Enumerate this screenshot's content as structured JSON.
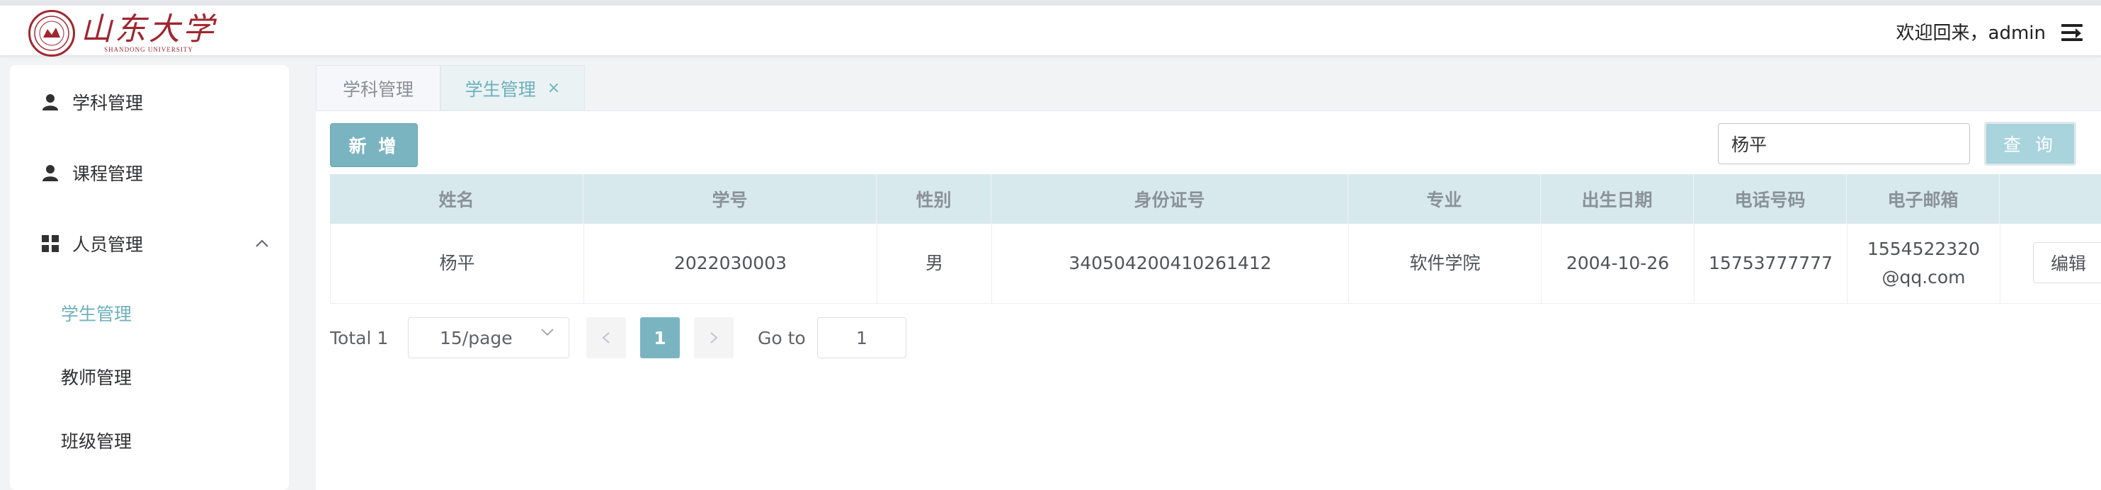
{
  "header": {
    "logo_cn": "山东大学",
    "logo_en": "SHANDONG UNIVERSITY",
    "welcome": "欢迎回来，admin",
    "menu_icon": "menu-fold-icon"
  },
  "sidebar": {
    "items": [
      {
        "label": "学科管理",
        "icon": "user-icon"
      },
      {
        "label": "课程管理",
        "icon": "user-icon"
      },
      {
        "label": "人员管理",
        "icon": "grid-icon",
        "expanded": true
      }
    ],
    "subitems": [
      {
        "label": "学生管理",
        "active": true
      },
      {
        "label": "教师管理",
        "active": false
      },
      {
        "label": "班级管理",
        "active": false
      }
    ]
  },
  "tabs": [
    {
      "label": "学科管理",
      "active": false
    },
    {
      "label": "学生管理",
      "active": true,
      "closable": true
    }
  ],
  "toolbar": {
    "add_label": "新 增",
    "search_value": "杨平",
    "query_label": "查 询"
  },
  "table": {
    "columns": [
      "姓名",
      "学号",
      "性别",
      "身份证号",
      "专业",
      "出生日期",
      "电话号码",
      "电子邮箱"
    ],
    "rows": [
      {
        "name": "杨平",
        "student_id": "2022030003",
        "gender": "男",
        "id_card": "340504200410261412",
        "major": "软件学院",
        "birth": "2004-10-26",
        "phone": "15753777777",
        "email_line1": "1554522320",
        "email_line2": "@qq.com",
        "edit_label": "编辑"
      }
    ]
  },
  "pagination": {
    "total": "Total 1",
    "page_size": "15/page",
    "current": "1",
    "goto_label": "Go to",
    "goto_value": "1"
  },
  "colors": {
    "accent": "#7ab4c1",
    "active_text": "#6fb0bd",
    "header_row": "#d8e9ed",
    "brand_red": "#a0262e"
  }
}
